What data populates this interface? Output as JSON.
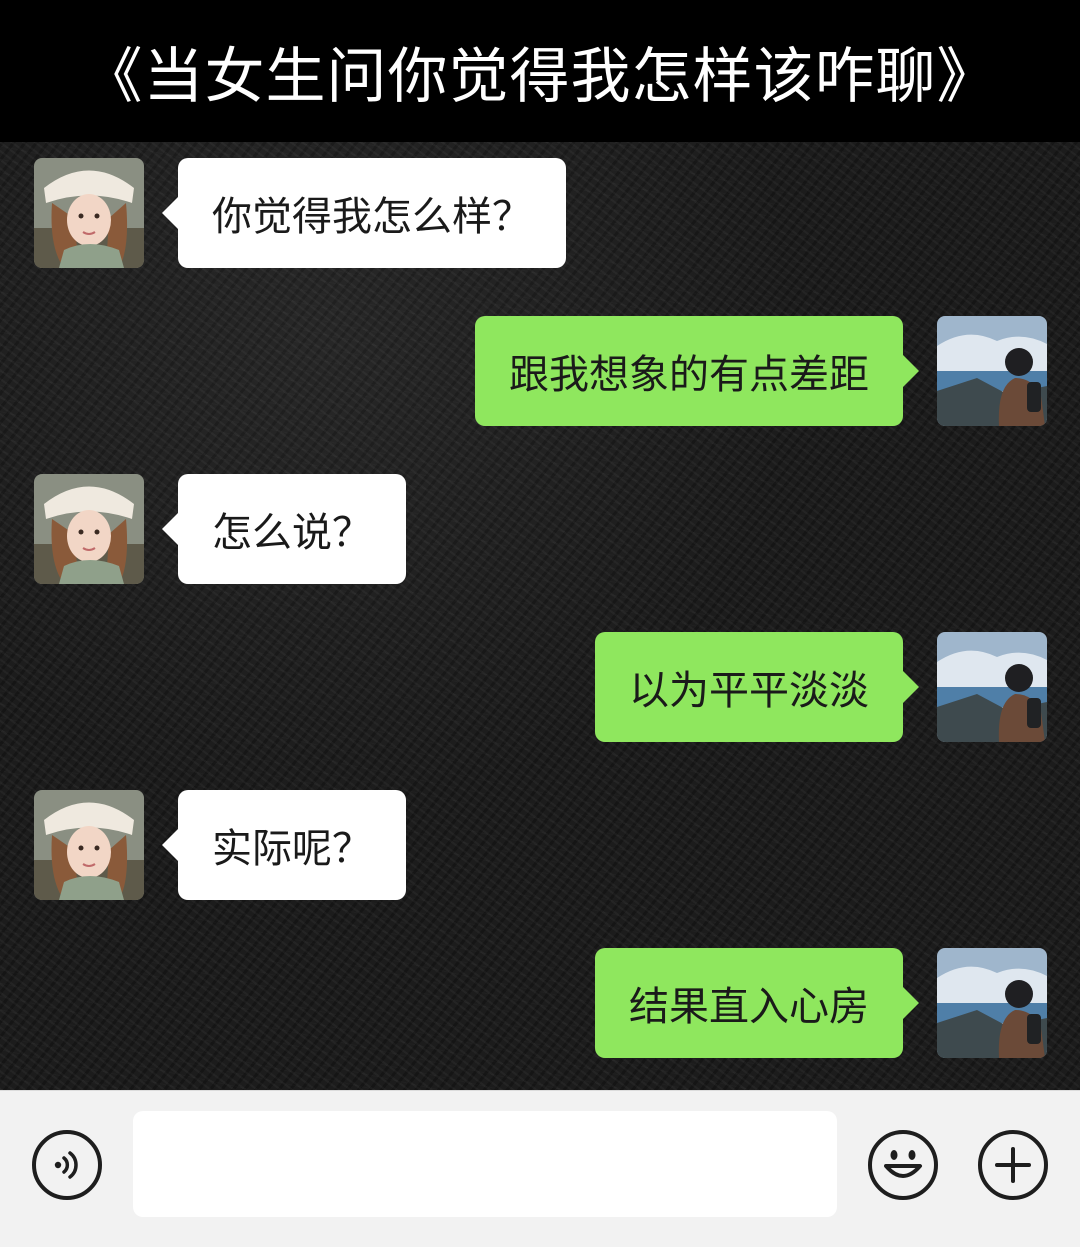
{
  "title": "《当女生问你觉得我怎样该咋聊》",
  "messages": [
    {
      "side": "left",
      "text": "你觉得我怎么样？"
    },
    {
      "side": "right",
      "text": "跟我想象的有点差距"
    },
    {
      "side": "left",
      "text": "怎么说？"
    },
    {
      "side": "right",
      "text": "以为平平淡淡"
    },
    {
      "side": "left",
      "text": "实际呢？"
    },
    {
      "side": "right",
      "text": "结果直入心房"
    }
  ],
  "input": {
    "value": ""
  },
  "icons": {
    "voice": "voice-icon",
    "emoji": "emoji-icon",
    "more": "plus-icon"
  },
  "colors": {
    "sent_bubble": "#8fe75e",
    "received_bubble": "#ffffff",
    "title_bar": "#000000"
  }
}
